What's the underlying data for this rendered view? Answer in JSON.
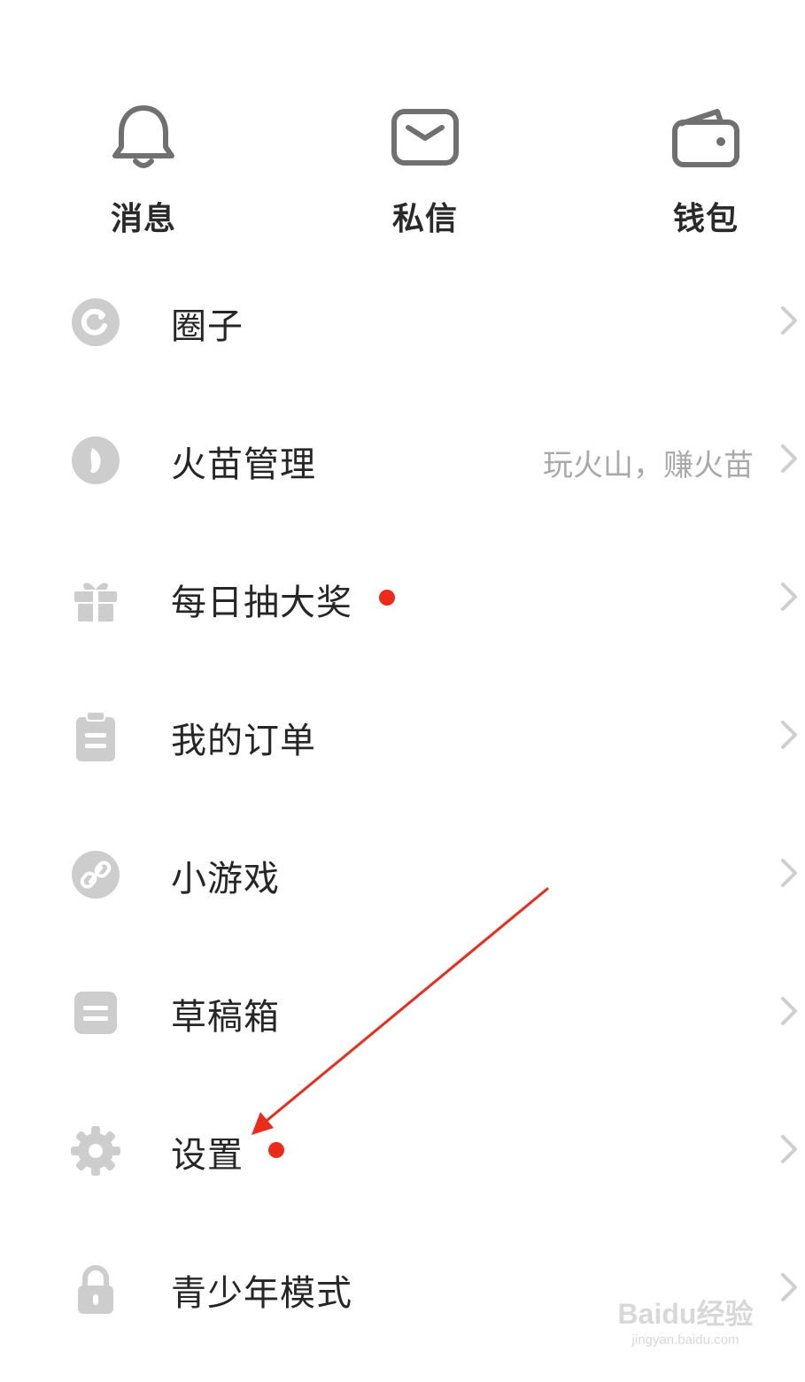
{
  "top_actions": [
    {
      "label": "消息",
      "icon": "bell-icon"
    },
    {
      "label": "私信",
      "icon": "mail-icon"
    },
    {
      "label": "钱包",
      "icon": "wallet-icon"
    }
  ],
  "menu": [
    {
      "label": "圈子",
      "icon": "circle-icon",
      "hint": "",
      "dot": false
    },
    {
      "label": "火苗管理",
      "icon": "flame-icon",
      "hint": "玩火山，赚火苗",
      "dot": false
    },
    {
      "label": "每日抽大奖",
      "icon": "gift-icon",
      "hint": "",
      "dot": true
    },
    {
      "label": "我的订单",
      "icon": "clipboard-icon",
      "hint": "",
      "dot": false
    },
    {
      "label": "小游戏",
      "icon": "link-icon",
      "hint": "",
      "dot": false
    },
    {
      "label": "草稿箱",
      "icon": "drafts-icon",
      "hint": "",
      "dot": false
    },
    {
      "label": "设置",
      "icon": "gear-icon",
      "hint": "",
      "dot": true
    },
    {
      "label": "青少年模式",
      "icon": "lock-icon",
      "hint": "",
      "dot": false
    }
  ],
  "watermark": {
    "main": "Baidu经验",
    "sub": "jingyan.baidu.com"
  },
  "colors": {
    "icon_gray": "#cdcdcd",
    "text": "#262626",
    "hint": "#a9a9a9",
    "dot_red": "#ee2a1a",
    "annotation_arrow": "#ee2a1a"
  }
}
